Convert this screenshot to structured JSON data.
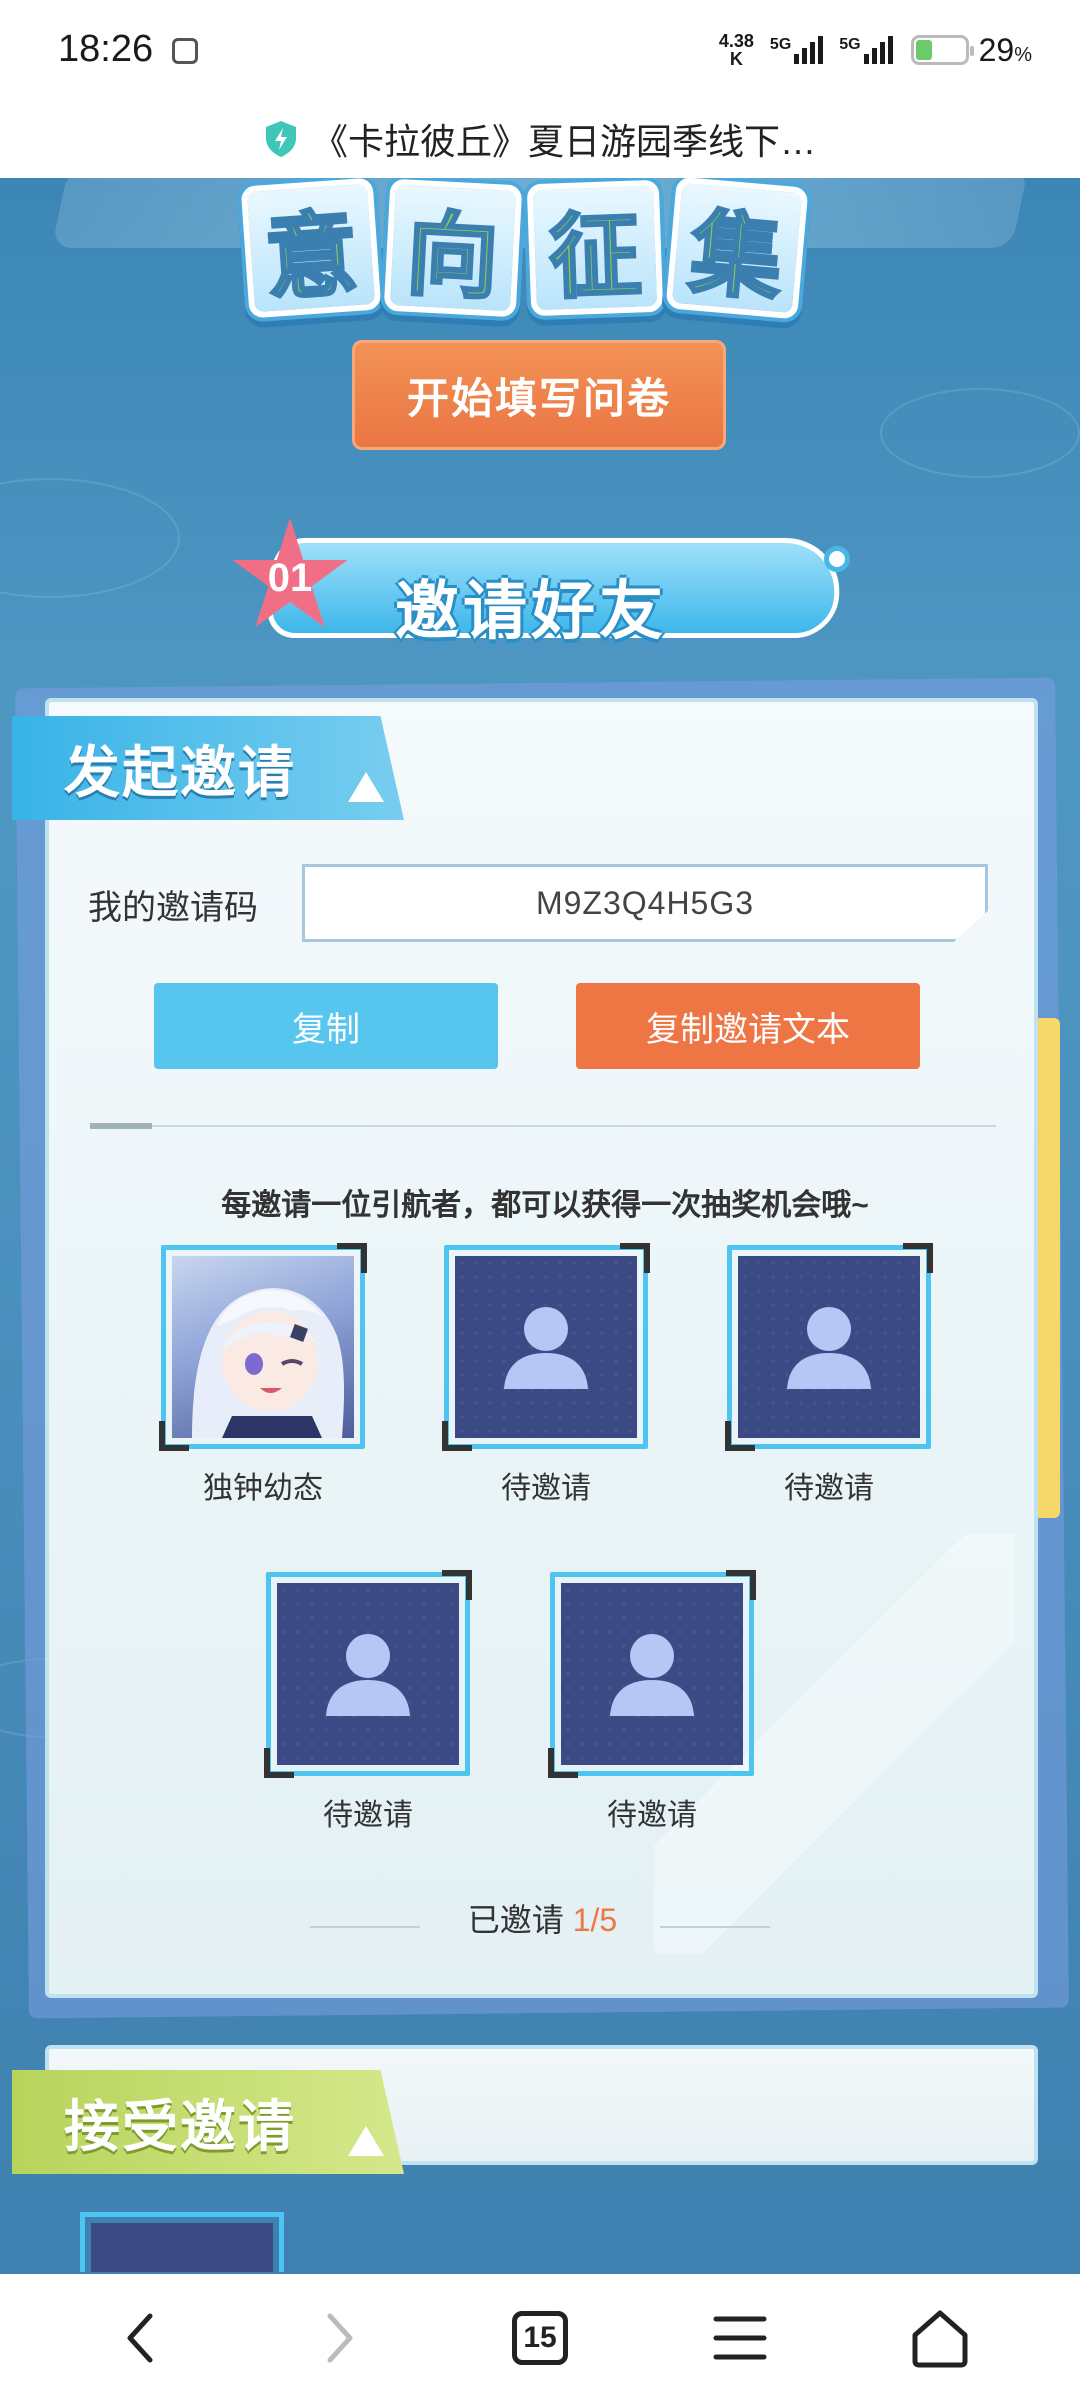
{
  "status_bar": {
    "time": "18:26",
    "network_speed_value": "4.38",
    "network_speed_unit": "K",
    "sim1_label": "5G",
    "sim2_label": "5G",
    "battery_percent": "29",
    "battery_percent_unit": "%",
    "battery_color": "#6cc96c"
  },
  "browser": {
    "page_title": "《卡拉彼丘》夏日游园季线下…",
    "tab_count": "15"
  },
  "banner": {
    "title_chars": [
      "意",
      "向",
      "征",
      "集"
    ],
    "survey_button_label": "开始填写问卷"
  },
  "section": {
    "number": "01",
    "title": "邀请好友"
  },
  "invite_panel": {
    "tab_title": "发起邀请",
    "code_label": "我的邀请码",
    "code_value": "M9Z3Q4H5G3",
    "copy_button_label": "复制",
    "copy_text_button_label": "复制邀请文本",
    "tip_text": "每邀请一位引航者，都可以获得一次抽奖机会哦~",
    "slots": [
      {
        "name": "独钟幼态",
        "filled": true
      },
      {
        "name": "待邀请",
        "filled": false
      },
      {
        "name": "待邀请",
        "filled": false
      },
      {
        "name": "待邀请",
        "filled": false
      },
      {
        "name": "待邀请",
        "filled": false
      }
    ],
    "invited_label": "已邀请",
    "invited_count": "1/5"
  },
  "accept_panel": {
    "tab_title": "接受邀请"
  },
  "colors": {
    "accent_orange": "#ee7645",
    "accent_blue": "#56c6ef",
    "accent_green": "#b7d45c"
  },
  "icons": {
    "status": [
      "notification-icon",
      "signal-icon",
      "battery-icon"
    ],
    "title": "shield-icon",
    "nav": [
      "back-icon",
      "forward-icon",
      "tabs-icon",
      "menu-icon",
      "home-icon"
    ]
  }
}
